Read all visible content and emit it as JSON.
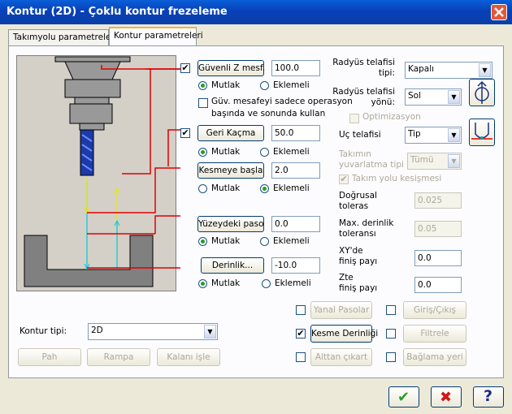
{
  "window": {
    "title": "Kontur (2D) - Çoklu kontur frezeleme"
  },
  "tabs": [
    "Takımyolu parametreleri",
    "Kontur parametreleri"
  ],
  "left": {
    "clearance": {
      "checked": true,
      "label": "Güvenli Z mesf.",
      "value": "100.0",
      "opt1": "Mutlak",
      "opt2": "Eklemeli",
      "selected": "Mutlak",
      "only_check": false,
      "only_label1": "Güv. mesafeyi sadece operasyon",
      "only_label2": "başında ve sonunda kullan"
    },
    "retract": {
      "checked": true,
      "label": "Geri Kaçma",
      "value": "50.0",
      "opt1": "Mutlak",
      "opt2": "Eklemeli",
      "selected": "Mutlak"
    },
    "feed": {
      "label": "Kesmeye başla",
      "value": "2.0",
      "opt1": "Mutlak",
      "opt2": "Eklemeli",
      "selected": "Eklemeli"
    },
    "top": {
      "label": "Yüzeydeki paso",
      "value": "0.0",
      "opt1": "Mutlak",
      "opt2": "Eklemeli",
      "selected": "Mutlak"
    },
    "depth": {
      "label": "Derinlik...",
      "value": "-10.0",
      "opt1": "Mutlak",
      "opt2": "Eklemeli",
      "selected": "Mutlak"
    }
  },
  "right": {
    "comp_type_label1": "Radyüs telafisi",
    "comp_type_label2": "tipi:",
    "comp_type_value": "Kapalı",
    "comp_dir_label1": "Radyüs telafisi",
    "comp_dir_label2": "yönü:",
    "comp_dir_value": "Sol",
    "optimize_label": "Optimizasyon",
    "tip_label": "Uç telafisi",
    "tip_value": "Tip",
    "roll_label1": "Takımın",
    "roll_label2": "yuvarlatma tipi",
    "roll_value": "Tümü",
    "infinite_label": "Takım yolu kesişmesi",
    "lin_label1": "Doğrusal",
    "lin_label2": "toleras",
    "lin_value": "0.025",
    "maxdepth_label1": "Max. derinlik",
    "maxdepth_label2": "toleransı",
    "maxdepth_value": "0.05",
    "xy_label1": "XY'de",
    "xy_label2": "finiş payı",
    "xy_value": "0.0",
    "z_label1": "Zte",
    "z_label2": "finiş payı",
    "z_value": "0.0"
  },
  "contour": {
    "label": "Kontur tipi:",
    "value": "2D"
  },
  "bottom_buttons": {
    "pah": "Pah",
    "rampa": "Rampa",
    "kalan": "Kalanı işle"
  },
  "options": {
    "multi": {
      "label": "Yanal Pasolar",
      "checked": false
    },
    "leadin": {
      "label": "Giriş/Çıkış",
      "checked": false
    },
    "depthcuts": {
      "label": "Kesme Derinliği",
      "checked": true
    },
    "filter": {
      "label": "Filtrele",
      "checked": false
    },
    "tabs": {
      "label": "Alttan çıkart",
      "checked": false
    },
    "locate": {
      "label": "Bağlama yeri",
      "checked": false
    }
  },
  "footer": {
    "ok": "✔",
    "cancel": "✖",
    "help": "?"
  },
  "colors": {
    "ok": "#2e9e2e",
    "cancel": "#d01818",
    "help": "#1a2f80",
    "lines": "#e00000"
  }
}
